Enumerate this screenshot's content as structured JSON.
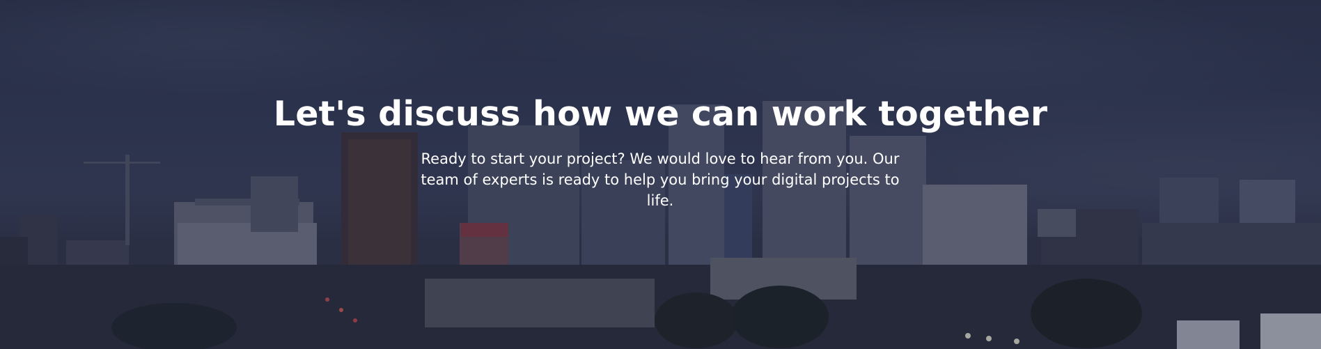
{
  "hero": {
    "title": "Let's discuss how we can work together",
    "subtitle": "Ready to start your project? We would love to hear from you. Our team of experts is ready to help you bring your digital projects to life.",
    "background_description_icon": "city-skyline-background",
    "overlay_color": "#1e233c"
  }
}
